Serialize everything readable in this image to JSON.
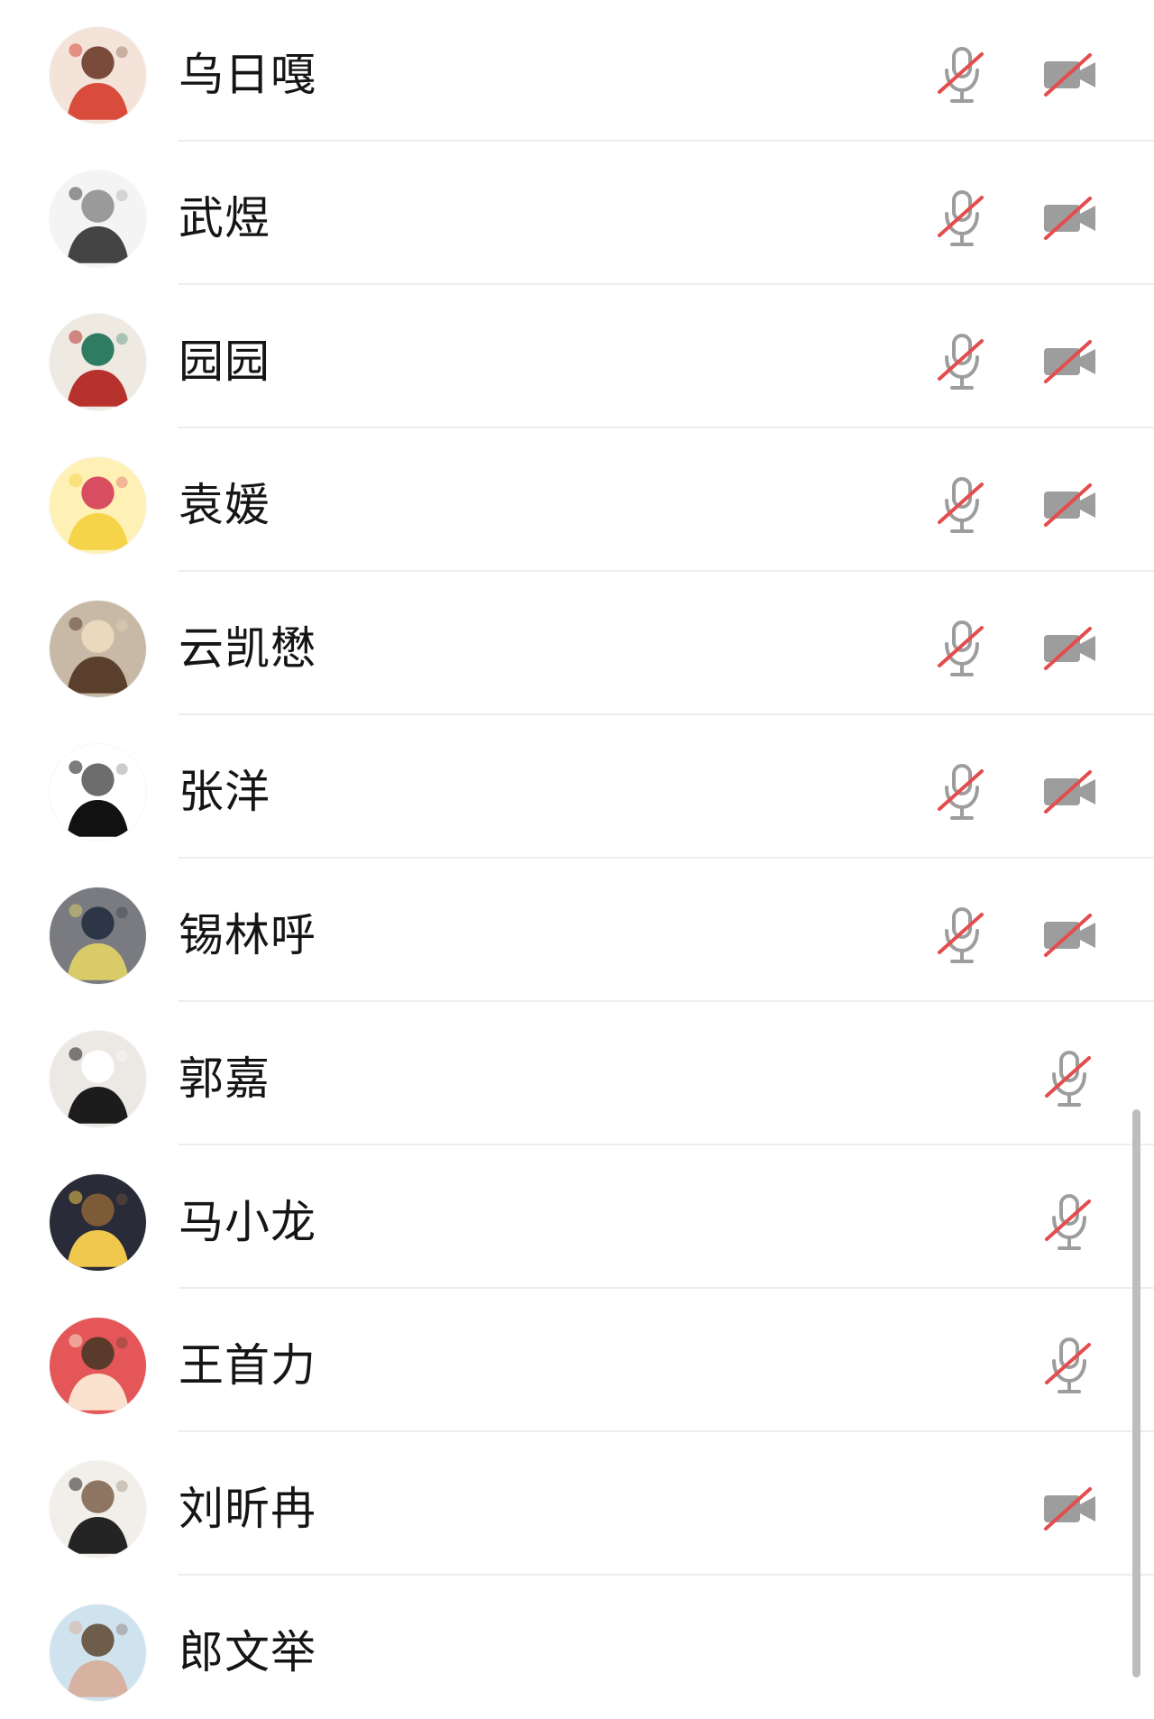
{
  "participants": [
    {
      "name": "乌日嘎",
      "mic_muted": true,
      "camera_off": true,
      "avatar_colors": [
        "#f3e3d9",
        "#d94b3b",
        "#7a4a3a"
      ]
    },
    {
      "name": "武煜",
      "mic_muted": true,
      "camera_off": true,
      "avatar_colors": [
        "#f4f4f4",
        "#444444",
        "#9a9a9a"
      ]
    },
    {
      "name": "园园",
      "mic_muted": true,
      "camera_off": true,
      "avatar_colors": [
        "#eeeae2",
        "#b8322d",
        "#2f7c63"
      ]
    },
    {
      "name": "袁媛",
      "mic_muted": true,
      "camera_off": true,
      "avatar_colors": [
        "#fff1b5",
        "#f6d44a",
        "#d84d60"
      ]
    },
    {
      "name": "云凯懋",
      "mic_muted": true,
      "camera_off": true,
      "avatar_colors": [
        "#c7b9a6",
        "#5b3f2d",
        "#ead9bc"
      ]
    },
    {
      "name": "张洋",
      "mic_muted": true,
      "camera_off": true,
      "avatar_colors": [
        "#ffffff",
        "#111111",
        "#6d6d6d"
      ]
    },
    {
      "name": "锡林呼",
      "mic_muted": true,
      "camera_off": true,
      "avatar_colors": [
        "#7a7b80",
        "#d9cb67",
        "#2c3646"
      ]
    },
    {
      "name": "郭嘉",
      "mic_muted": true,
      "camera_off": false,
      "avatar_colors": [
        "#ece9e5",
        "#1c1c1c",
        "#ffffff"
      ]
    },
    {
      "name": "马小龙",
      "mic_muted": true,
      "camera_off": false,
      "avatar_colors": [
        "#2a2b38",
        "#f0c84e",
        "#7e5b37"
      ]
    },
    {
      "name": "王首力",
      "mic_muted": true,
      "camera_off": false,
      "avatar_colors": [
        "#e45657",
        "#fae2cf",
        "#5a3b2b"
      ]
    },
    {
      "name": "刘昕冉",
      "mic_muted": false,
      "camera_off": true,
      "avatar_colors": [
        "#f2eee9",
        "#242424",
        "#8d7562"
      ]
    },
    {
      "name": "郎文举",
      "mic_muted": false,
      "camera_off": false,
      "avatar_colors": [
        "#cfe3ef",
        "#d8b2a0",
        "#6f5d4b"
      ]
    }
  ],
  "icons": {
    "mic": "mic-muted-icon",
    "camera": "camera-off-icon"
  },
  "colors": {
    "icon_gray": "#9d9d9d",
    "slash_red": "#e34d4d",
    "divider": "#ededed",
    "scrollbar": "#bdbdbd"
  }
}
